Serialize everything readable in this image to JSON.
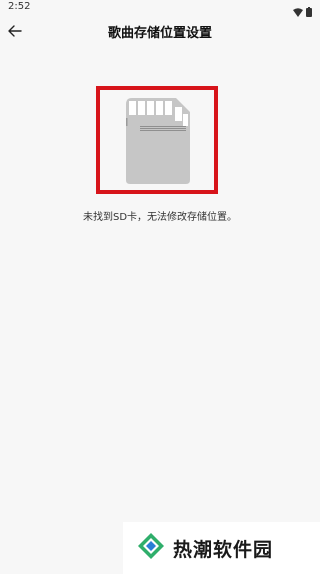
{
  "status_bar": {
    "time": "2:52",
    "icons": [
      "wifi-icon",
      "battery-icon"
    ]
  },
  "app_bar": {
    "back_icon": "arrow-left-icon",
    "title": "歌曲存储位置设置"
  },
  "content": {
    "illustration": "sd-card-icon",
    "message": "未找到SD卡，无法修改存储位置。"
  },
  "watermark": {
    "text": "热潮软件园"
  },
  "colors": {
    "background": "#f7f7f7",
    "highlight_border": "#d7141a",
    "sd_card": "#c6c6c6"
  }
}
